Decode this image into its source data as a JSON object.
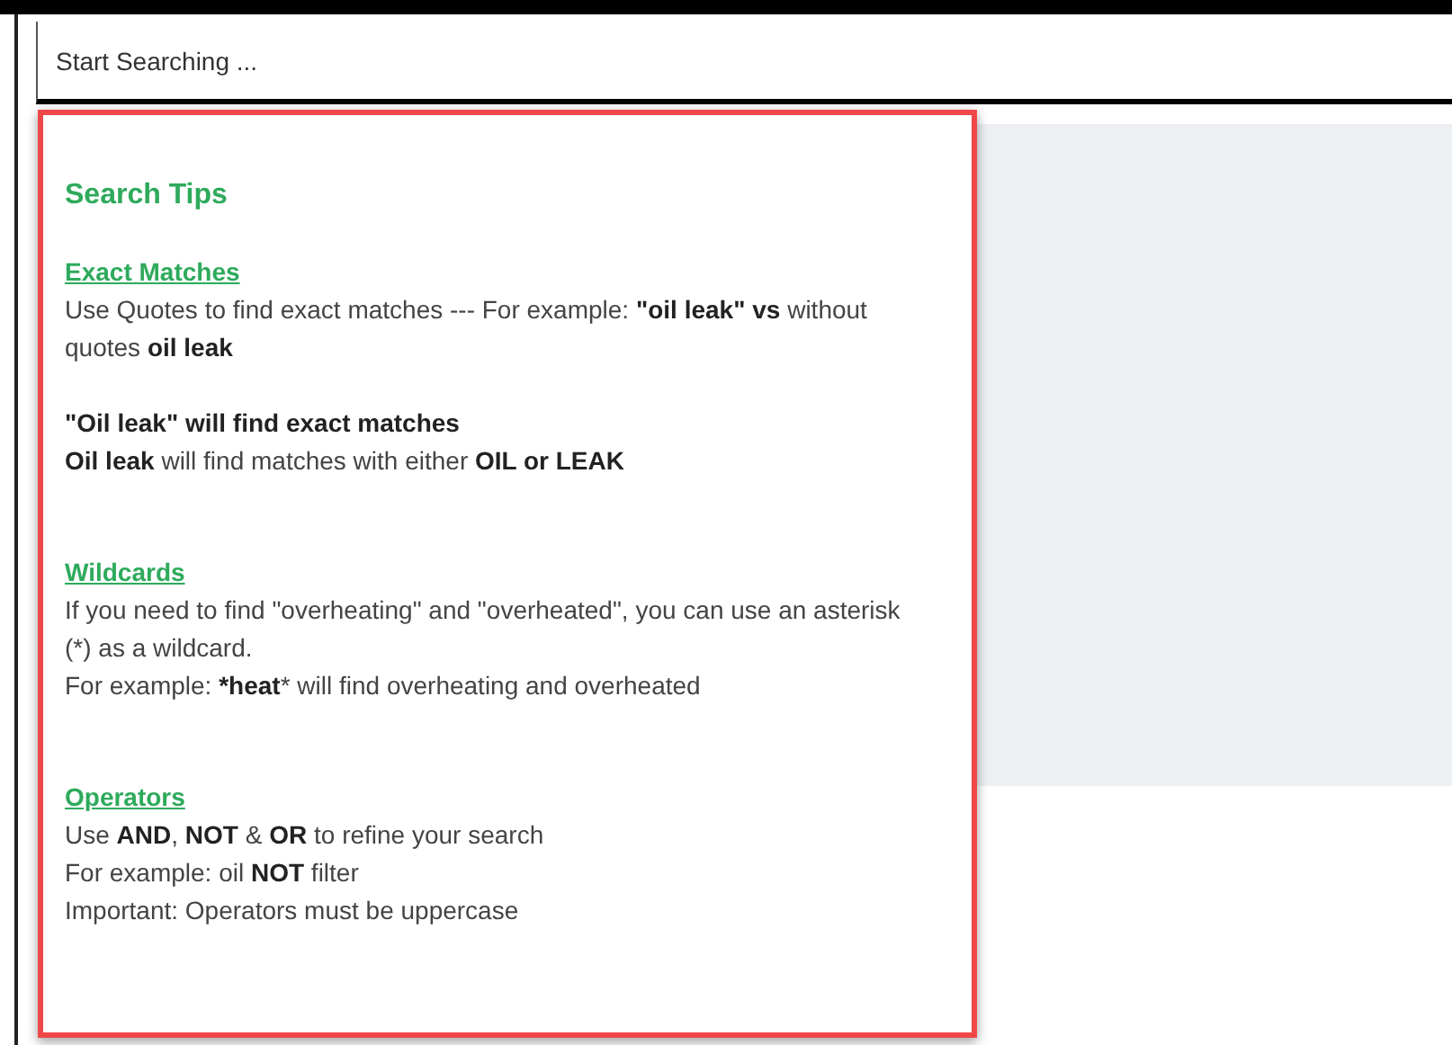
{
  "search": {
    "placeholder": "Start Searching ..."
  },
  "tips": {
    "title": "Search Tips",
    "sections": [
      {
        "heading": "Exact Matches",
        "paragraphs": [
          [
            {
              "text": "Use Quotes to find exact matches --- For example: **\"oil leak\" vs** without quotes **oil leak**",
              "bold": false
            }
          ],
          [
            {
              "text": "\"Oil leak\" will find exact matches",
              "bold": true
            },
            {
              "text": "**Oil leak** will find matches with either **OIL or LEAK**",
              "bold": false
            }
          ]
        ]
      },
      {
        "heading": "Wildcards",
        "paragraphs": [
          [
            {
              "text": "If you need to find \"overheating\" and \"overheated\", you can use an asterisk (*) as a wildcard.",
              "bold": false
            },
            {
              "text": "For example: ***heat*** will find overheating and overheated",
              "bold": false
            }
          ]
        ]
      },
      {
        "heading": "Operators",
        "paragraphs": [
          [
            {
              "text": "Use **AND**, **NOT** & **OR** to refine your search",
              "bold": false
            },
            {
              "text": "For example: oil **NOT** filter",
              "bold": false
            },
            {
              "text": "Important: Operators must be uppercase",
              "bold": false
            }
          ]
        ]
      }
    ]
  }
}
